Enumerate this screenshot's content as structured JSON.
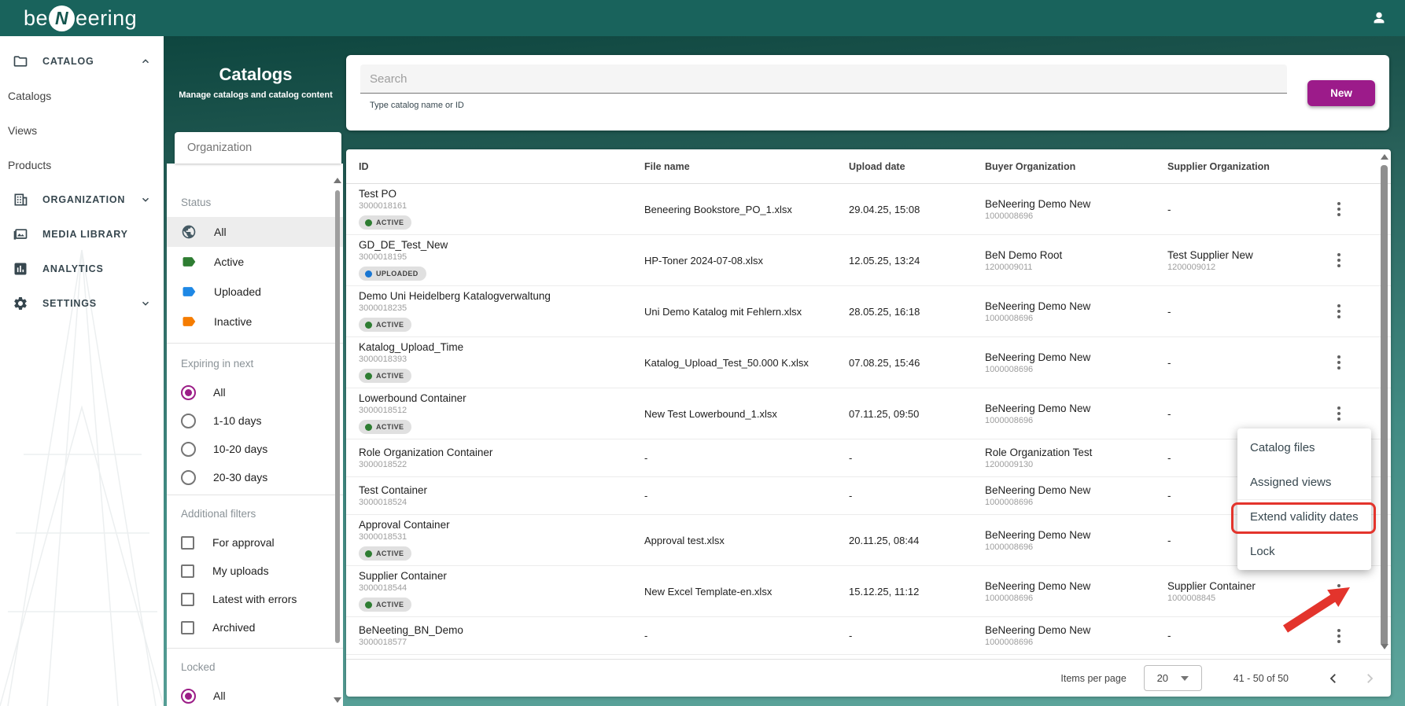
{
  "app_bar": {
    "logo_pre": "be",
    "logo_n": "N",
    "logo_post": "eering"
  },
  "sidebar": {
    "sections": [
      {
        "label": "CATALOG",
        "icon": "folder-icon",
        "chevron": "up"
      },
      {
        "label": "ORGANIZATION",
        "icon": "building-icon",
        "chevron": "down"
      },
      {
        "label": "MEDIA LIBRARY",
        "icon": "media-library-icon",
        "chevron": ""
      },
      {
        "label": "ANALYTICS",
        "icon": "analytics-icon",
        "chevron": ""
      },
      {
        "label": "SETTINGS",
        "icon": "gear-icon",
        "chevron": "down"
      }
    ],
    "catalog_children": [
      "Catalogs",
      "Views",
      "Products"
    ]
  },
  "header": {
    "title": "Catalogs",
    "subtitle": "Manage catalogs and catalog content"
  },
  "search": {
    "placeholder": "Search",
    "helper": "Type catalog name or ID",
    "new_button": "New"
  },
  "filters": {
    "organization_placeholder": "Organization",
    "status": {
      "label": "Status",
      "options": [
        {
          "label": "All",
          "icon": "globe-icon",
          "color": "#455a64",
          "selected": true
        },
        {
          "label": "Active",
          "icon": "tag-icon",
          "color": "#2e7d32",
          "selected": false
        },
        {
          "label": "Uploaded",
          "icon": "tag-icon",
          "color": "#1e88e5",
          "selected": false
        },
        {
          "label": "Inactive",
          "icon": "tag-icon",
          "color": "#f57c00",
          "selected": false
        }
      ]
    },
    "expiring": {
      "label": "Expiring in next",
      "options": [
        {
          "label": "All",
          "selected": true
        },
        {
          "label": "1-10 days",
          "selected": false
        },
        {
          "label": "10-20 days",
          "selected": false
        },
        {
          "label": "20-30 days",
          "selected": false
        }
      ]
    },
    "additional": {
      "label": "Additional filters",
      "options": [
        "For approval",
        "My uploads",
        "Latest with errors",
        "Archived"
      ]
    },
    "locked": {
      "label": "Locked",
      "options": [
        {
          "label": "All",
          "selected": true
        }
      ]
    }
  },
  "table": {
    "columns": [
      "ID",
      "File name",
      "Upload date",
      "Buyer Organization",
      "Supplier Organization"
    ],
    "rows": [
      {
        "name": "Test PO",
        "id": "3000018161",
        "status": "ACTIVE",
        "status_color": "green",
        "file": "Beneering Bookstore_PO_1.xlsx",
        "date": "29.04.25, 15:08",
        "buyer": "BeNeering Demo New",
        "buyer_id": "1000008696",
        "supplier": "-",
        "supplier_id": ""
      },
      {
        "name": "GD_DE_Test_New",
        "id": "3000018195",
        "status": "UPLOADED",
        "status_color": "blue",
        "file": "HP-Toner 2024-07-08.xlsx",
        "date": "12.05.25, 13:24",
        "buyer": "BeN Demo Root",
        "buyer_id": "1200009011",
        "supplier": "Test Supplier New",
        "supplier_id": "1200009012"
      },
      {
        "name": "Demo Uni Heidelberg Katalogverwaltung",
        "id": "3000018235",
        "status": "ACTIVE",
        "status_color": "green",
        "file": "Uni Demo Katalog mit Fehlern.xlsx",
        "date": "28.05.25, 16:18",
        "buyer": "BeNeering Demo New",
        "buyer_id": "1000008696",
        "supplier": "-",
        "supplier_id": ""
      },
      {
        "name": "Katalog_Upload_Time",
        "id": "3000018393",
        "status": "ACTIVE",
        "status_color": "green",
        "file": "Katalog_Upload_Test_50.000 K.xlsx",
        "date": "07.08.25, 15:46",
        "buyer": "BeNeering Demo New",
        "buyer_id": "1000008696",
        "supplier": "-",
        "supplier_id": ""
      },
      {
        "name": "Lowerbound Container",
        "id": "3000018512",
        "status": "ACTIVE",
        "status_color": "green",
        "file": "New Test Lowerbound_1.xlsx",
        "date": "07.11.25, 09:50",
        "buyer": "BeNeering Demo New",
        "buyer_id": "1000008696",
        "supplier": "-",
        "supplier_id": ""
      },
      {
        "name": "Role Organization Container",
        "id": "3000018522",
        "status": "",
        "status_color": "",
        "file": "-",
        "date": "-",
        "buyer": "Role Organization Test",
        "buyer_id": "1200009130",
        "supplier": "-",
        "supplier_id": ""
      },
      {
        "name": "Test Container",
        "id": "3000018524",
        "status": "",
        "status_color": "",
        "file": "-",
        "date": "-",
        "buyer": "BeNeering Demo New",
        "buyer_id": "1000008696",
        "supplier": "-",
        "supplier_id": ""
      },
      {
        "name": "Approval Container",
        "id": "3000018531",
        "status": "ACTIVE",
        "status_color": "green",
        "file": "Approval test.xlsx",
        "date": "20.11.25, 08:44",
        "buyer": "BeNeering Demo New",
        "buyer_id": "1000008696",
        "supplier": "-",
        "supplier_id": ""
      },
      {
        "name": "Supplier Container",
        "id": "3000018544",
        "status": "ACTIVE",
        "status_color": "green",
        "file": "New Excel Template-en.xlsx",
        "date": "15.12.25, 11:12",
        "buyer": "BeNeering Demo New",
        "buyer_id": "1000008696",
        "supplier": "Supplier Container",
        "supplier_id": "1000008845"
      },
      {
        "name": "BeNeeting_BN_Demo",
        "id": "3000018577",
        "status": "",
        "status_color": "",
        "file": "-",
        "date": "-",
        "buyer": "BeNeering Demo New",
        "buyer_id": "1000008696",
        "supplier": "-",
        "supplier_id": ""
      }
    ]
  },
  "context_menu": {
    "items": [
      "Catalog files",
      "Assigned views",
      "Extend validity dates",
      "Lock"
    ],
    "highlighted_item": "Extend validity dates"
  },
  "pagination": {
    "items_per_page_label": "Items per page",
    "items_per_page": "20",
    "range": "41 - 50 of 50"
  },
  "colors": {
    "accent_teal": "#19635c",
    "brand_purple": "#9c1b8a",
    "radio_purple": "#9c1d87",
    "annotation_red": "#e3342c",
    "status_active": "#2e7d32",
    "status_uploaded": "#1976d2",
    "status_inactive": "#f57c00"
  }
}
